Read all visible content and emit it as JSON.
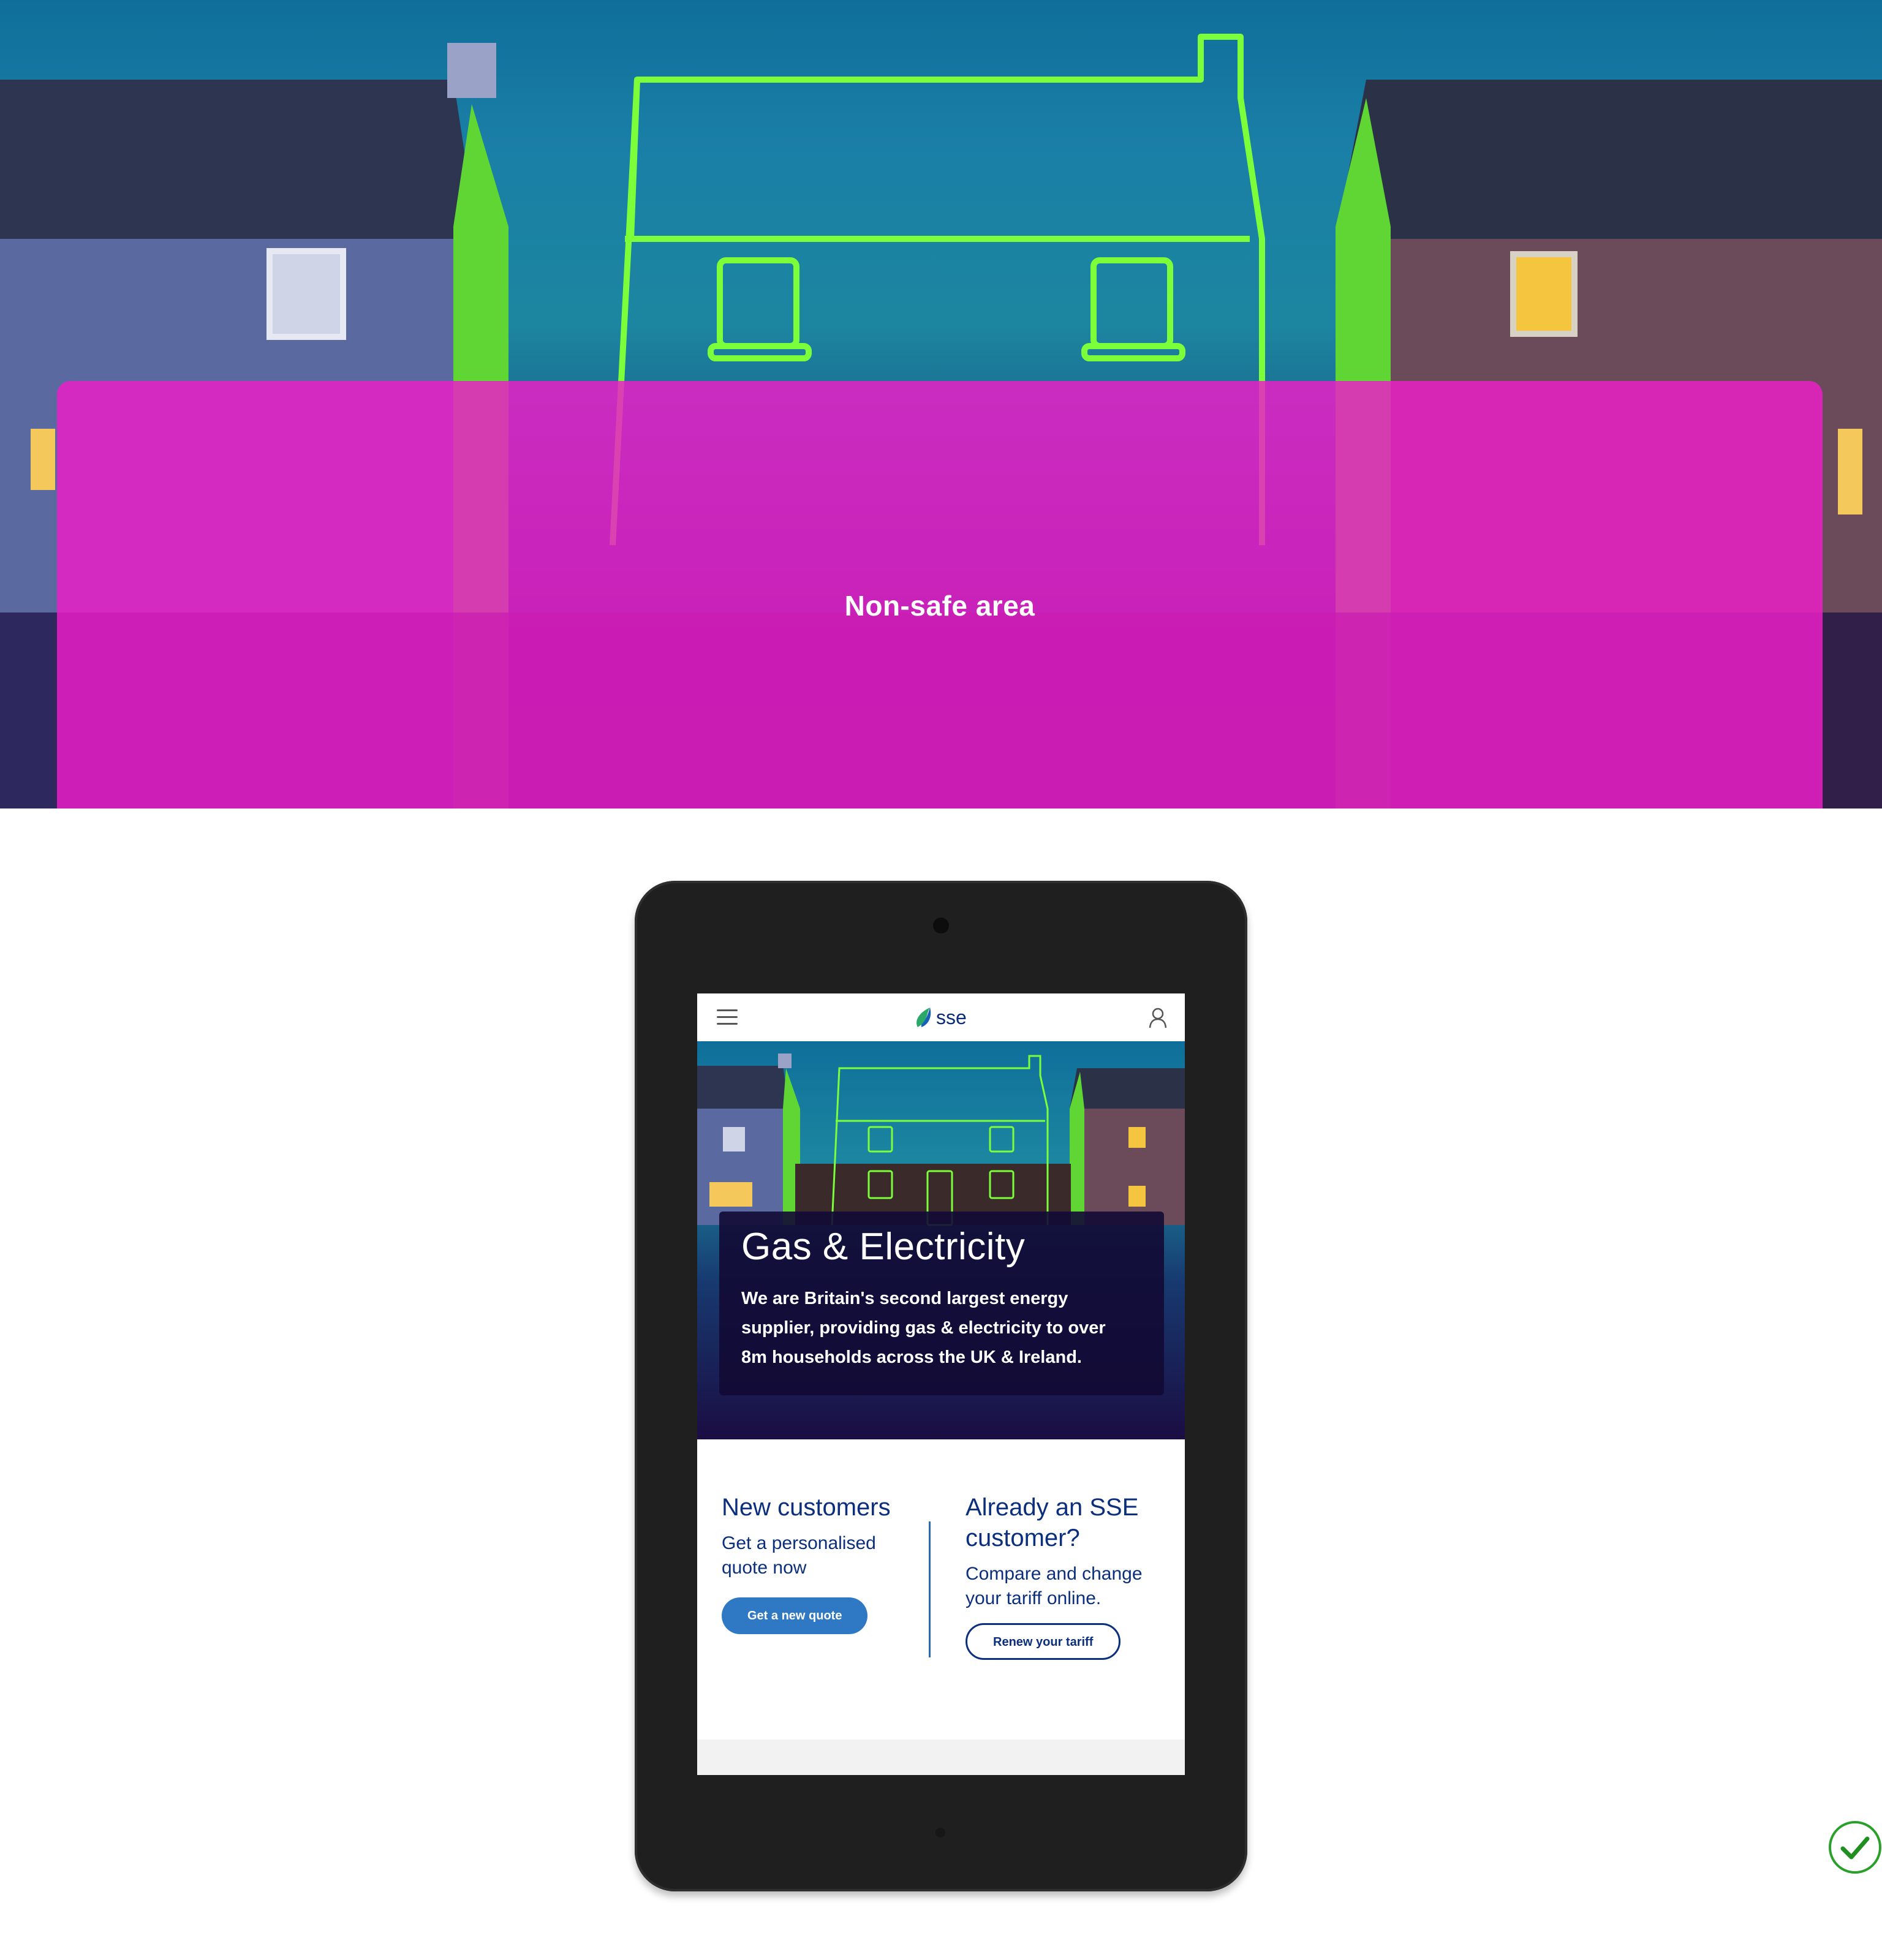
{
  "overlay": {
    "label": "Non-safe area"
  },
  "app": {
    "logo_text": "sse"
  },
  "hero": {
    "title": "Gas & Electricity",
    "body": "We are Britain's second largest energy supplier, providing gas & electricity to over 8m households across the UK & Ireland."
  },
  "new_customers": {
    "heading": "New customers",
    "subtext": "Get a personalised quote now",
    "button": "Get a new quote"
  },
  "existing_customers": {
    "heading": "Already an SSE customer?",
    "subtext": "Compare and change your tariff online.",
    "button": "Renew your tariff"
  },
  "icons": {
    "menu": "hamburger-menu-icon",
    "account": "user-account-icon",
    "logo": "sse-logo-icon",
    "status": "checkmark-icon"
  },
  "colors": {
    "overlay": "#ec1ec8",
    "brand_blue": "#0b2f7d",
    "button_blue": "#2f78c4",
    "neon_green": "#7cff3a",
    "check_green": "#2aa02a"
  }
}
